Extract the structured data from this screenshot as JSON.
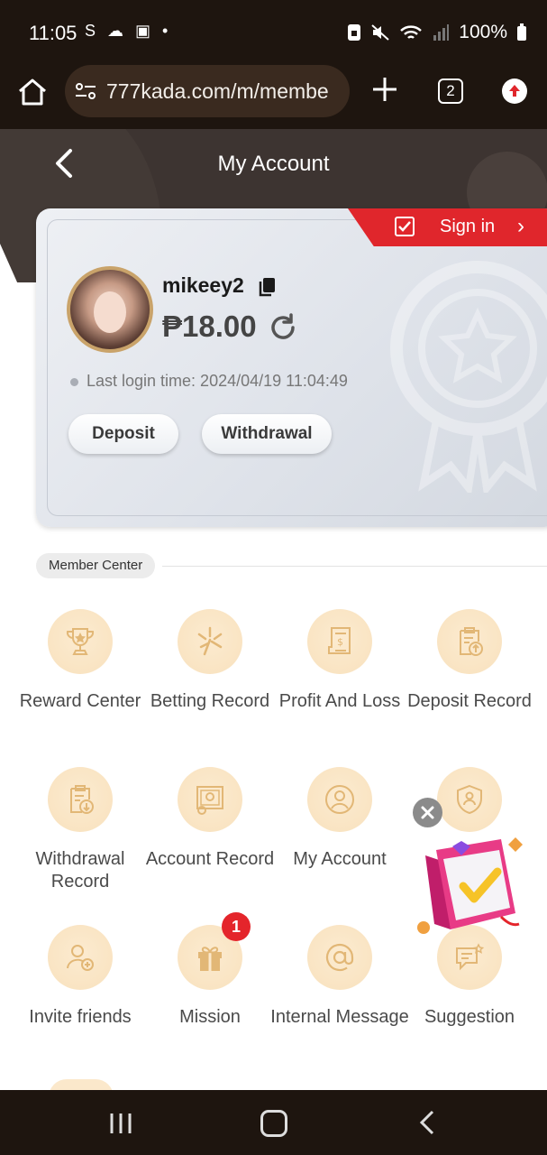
{
  "status_bar": {
    "time": "11:05",
    "notification_icons": "S ☁ ▣ •",
    "battery": "100%"
  },
  "browser": {
    "url": "777kada.com/m/membe",
    "tab_count": "2"
  },
  "header": {
    "title": "My Account"
  },
  "account": {
    "sign_in_label": "Sign in",
    "username": "mikeey2",
    "balance": "₱18.00",
    "last_login": "Last login time: 2024/04/19 11:04:49",
    "deposit_label": "Deposit",
    "withdrawal_label": "Withdrawal"
  },
  "member_center": {
    "section_label": "Member Center",
    "items": [
      {
        "label": "Reward Center",
        "icon": "trophy-icon"
      },
      {
        "label": "Betting Record",
        "icon": "sparkle-icon"
      },
      {
        "label": "Profit And Loss",
        "icon": "invoice-icon"
      },
      {
        "label": "Deposit Record",
        "icon": "clipboard-upload-icon"
      },
      {
        "label": "Withdrawal Record",
        "icon": "clipboard-download-icon"
      },
      {
        "label": "Account Record",
        "icon": "certificate-icon"
      },
      {
        "label": "My Account",
        "icon": "user-icon"
      },
      {
        "label": "",
        "icon": "shield-user-icon"
      },
      {
        "label": "Invite friends",
        "icon": "add-user-icon"
      },
      {
        "label": "Mission",
        "icon": "gift-icon",
        "badge": "1"
      },
      {
        "label": "Internal Message",
        "icon": "at-icon"
      },
      {
        "label": "Suggestion",
        "icon": "chat-icon"
      }
    ]
  },
  "colors": {
    "accent_gold": "#c9a36a",
    "icon_bg": "#fbe8cb",
    "signin_red": "#e0262c",
    "dark_bg": "#1e150f"
  }
}
